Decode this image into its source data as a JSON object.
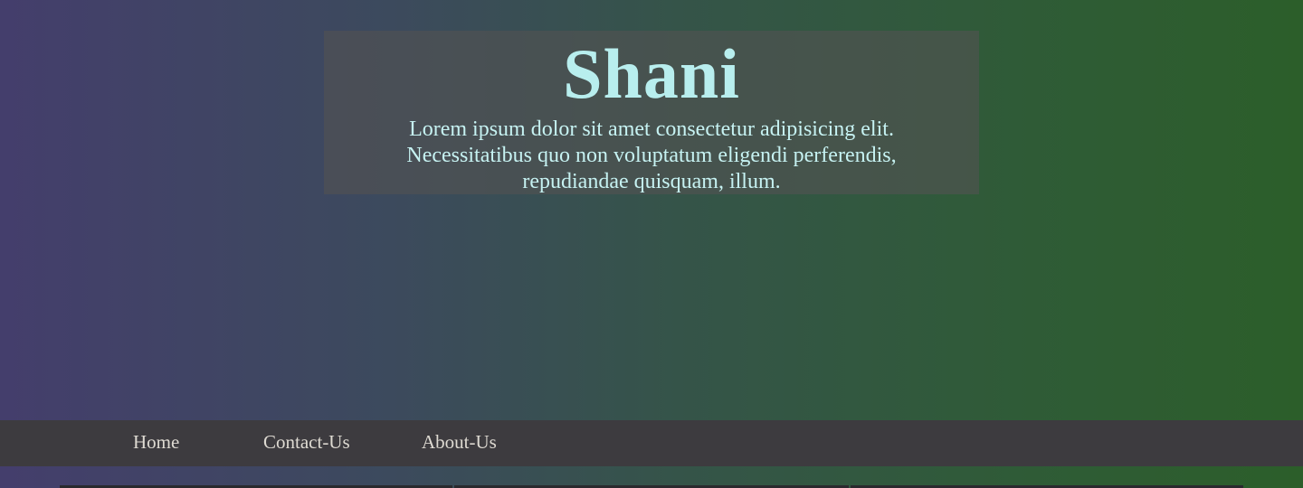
{
  "hero": {
    "title": "Shani",
    "description": "Lorem ipsum dolor sit amet consectetur adipisicing elit. Necessitatibus quo non voluptatum eligendi perferendis, repudiandae quisquam, illum."
  },
  "nav": {
    "items": [
      {
        "label": "Home"
      },
      {
        "label": "Contact-Us"
      },
      {
        "label": "About-Us"
      }
    ]
  },
  "colors": {
    "gradient_left": "#443e6c",
    "gradient_right": "#2c5e2a",
    "title_text": "#b8eeee",
    "navbar_bg": "#3d3b3f",
    "nav_text": "#dedad2"
  }
}
